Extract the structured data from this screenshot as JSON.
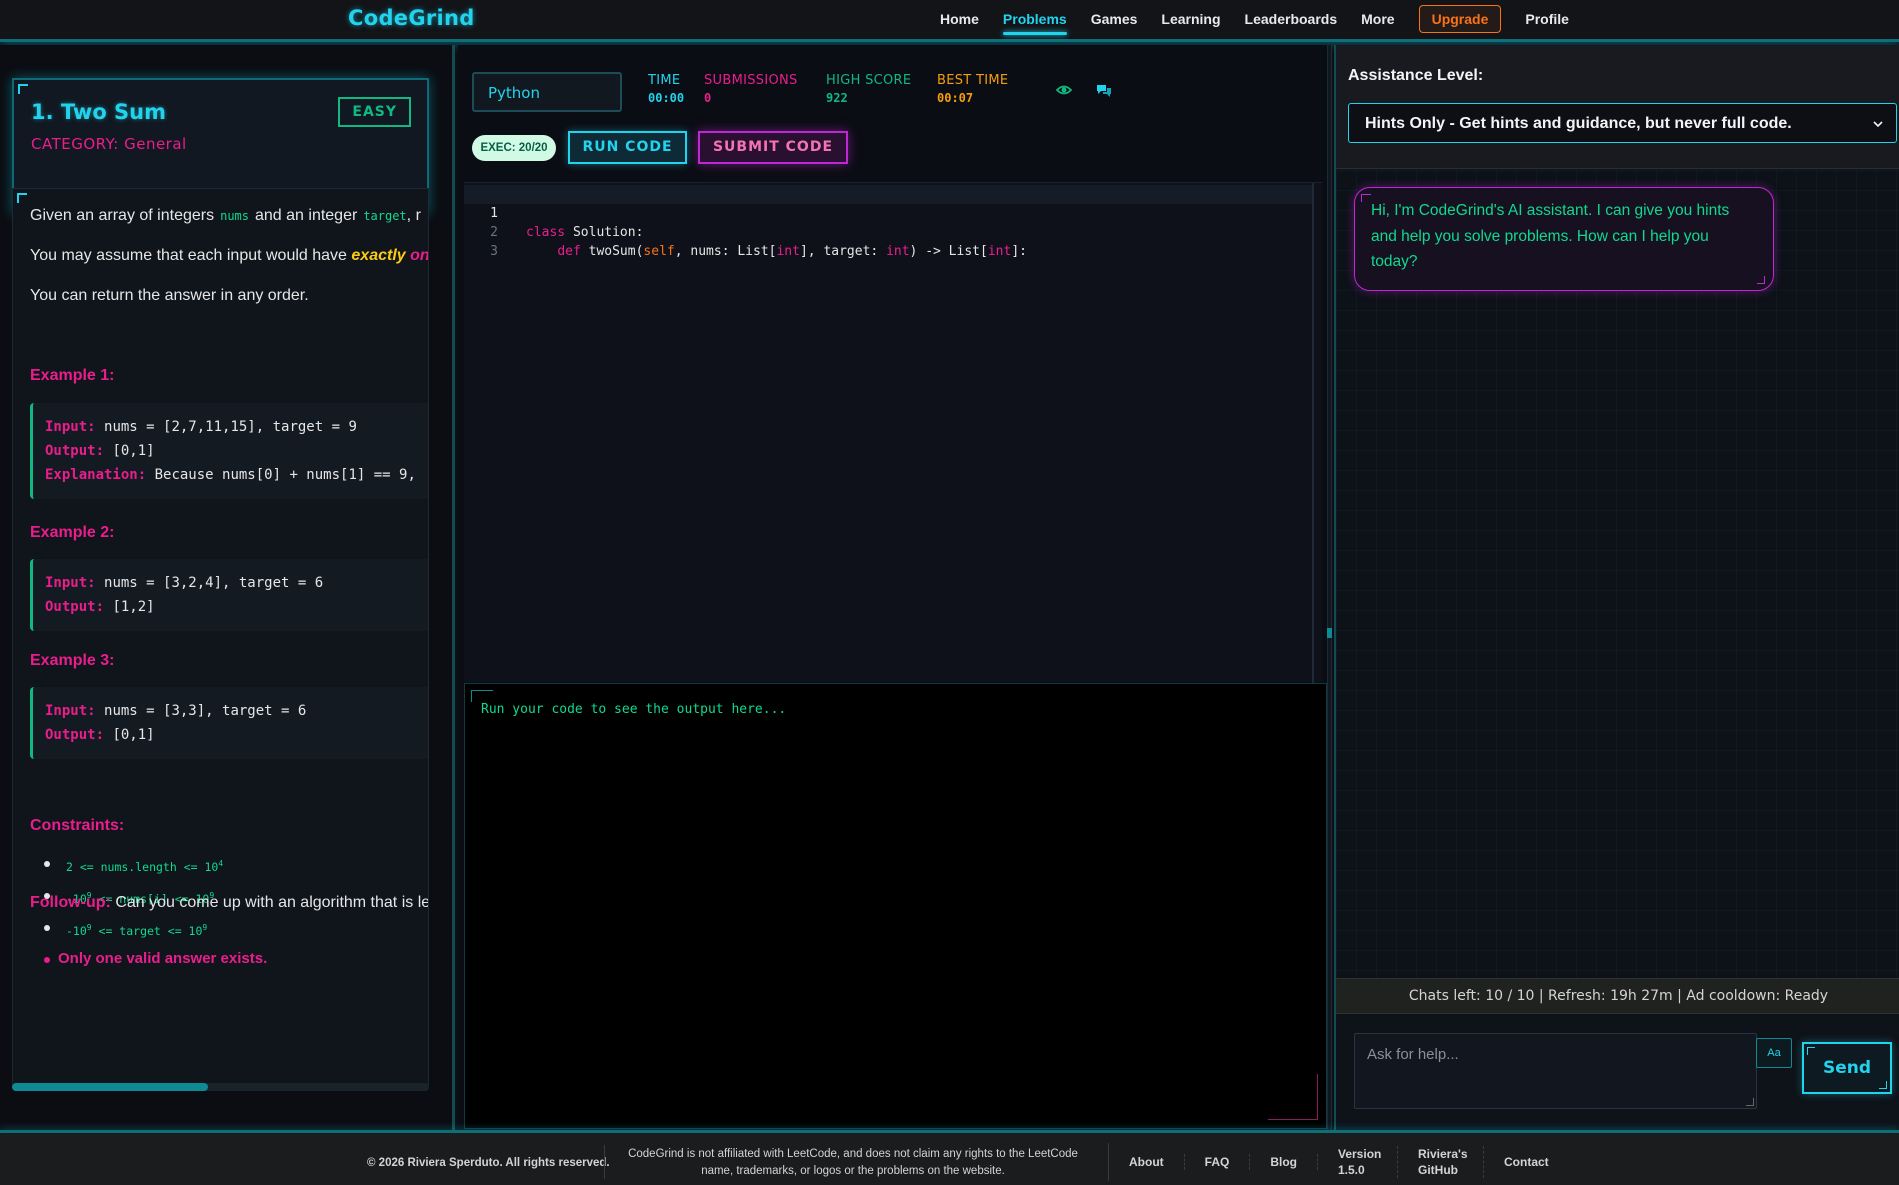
{
  "nav": {
    "logo": "CodeGrind",
    "items": [
      {
        "label": "Home",
        "active": false
      },
      {
        "label": "Problems",
        "active": true
      },
      {
        "label": "Games",
        "active": false
      },
      {
        "label": "Learning",
        "active": false
      },
      {
        "label": "Leaderboards",
        "active": false
      },
      {
        "label": "More",
        "active": false
      }
    ],
    "upgrade": "Upgrade",
    "profile": "Profile"
  },
  "problem": {
    "title": "1. Two Sum",
    "difficulty": "EASY",
    "category": "CATEGORY: General",
    "desc1_before": "Given an array of integers",
    "desc1_code1": "nums",
    "desc1_mid": "and an integer",
    "desc1_code2": "target",
    "desc1_after": ", r",
    "desc2_before": "You may assume that each input would have",
    "desc2_em": "exactly",
    "desc2_after": "one",
    "desc3": "You can return the answer in any order.",
    "examples": [
      {
        "heading": "Example 1:",
        "input_label": "Input:",
        "input": "nums = [2,7,11,15], target = 9",
        "output_label": "Output:",
        "output": "[0,1]",
        "explanation_label": "Explanation:",
        "explanation": "Because nums[0] + nums[1] == 9,"
      },
      {
        "heading": "Example 2:",
        "input_label": "Input:",
        "input": "nums = [3,2,4], target = 6",
        "output_label": "Output:",
        "output": "[1,2]"
      },
      {
        "heading": "Example 3:",
        "input_label": "Input:",
        "input": "nums = [3,3], target = 6",
        "output_label": "Output:",
        "output": "[0,1]"
      }
    ],
    "constraints_heading": "Constraints:",
    "constraints": [
      {
        "pre": "2 <= nums.length <= 10",
        "sup": "4",
        "post": ""
      },
      {
        "pre": "-10",
        "sup": "9",
        "post": " <= nums[i] <= 10",
        "sup2": "9"
      },
      {
        "pre": "-10",
        "sup": "9",
        "post": " <= target <= 10",
        "sup2": "9"
      }
    ],
    "constraint_bold": "Only one valid answer exists.",
    "followup_label": "Follow-up:",
    "followup_text": "Can you come up with an algorithm that is le",
    "scroll_progress": 0.47
  },
  "editor": {
    "language": "Python",
    "stats": [
      {
        "label": "TIME",
        "value": "00:00",
        "color": "#22d3ee"
      },
      {
        "label": "SUBMISSIONS",
        "value": "0",
        "color": "#e91e8c"
      },
      {
        "label": "HIGH SCORE",
        "value": "922",
        "color": "#10b981"
      },
      {
        "label": "BEST TIME",
        "value": "00:07",
        "color": "#f59e0b"
      }
    ],
    "exec": "EXEC: 20/20",
    "run_label": "RUN CODE",
    "submit_label": "SUBMIT CODE",
    "lines": [
      {
        "n": "1",
        "kw": "class",
        "rest": " Solution:"
      },
      {
        "n": "2",
        "indent": "    ",
        "kw": "def",
        "rest": " twoSum(",
        "p_self": "self",
        "p_rest1": ", nums: List[",
        "t1": "int",
        "p_rest2": "], target: ",
        "t2": "int",
        "p_rest3": ") -> List[",
        "t3": "int",
        "p_rest4": "]:"
      },
      {
        "n": "3"
      }
    ],
    "output_placeholder": "Run your code to see the output here..."
  },
  "assistant": {
    "level_label": "Assistance Level:",
    "level_value": "Hints Only - Get hints and guidance, but never full code.",
    "greeting": "Hi, I'm CodeGrind's AI assistant. I can give you hints and help you solve problems. How can I help you today?",
    "chats_left": "Chats left: 10 / 10 | Refresh: 19h 27m | Ad cooldown: Ready",
    "input_placeholder": "Ask for help...",
    "font_button": "Aa",
    "send": "Send"
  },
  "footer": {
    "copyright": "© 2026 Riviera Sperduto. All rights reserved.",
    "disclaimer": "CodeGrind is not affiliated with LeetCode, and does not claim any rights to the LeetCode name, trademarks, or logos or the problems on the website.",
    "links": [
      "About",
      "FAQ",
      "Blog",
      "Version 1.5.0",
      "Riviera's GitHub",
      "Contact"
    ]
  }
}
